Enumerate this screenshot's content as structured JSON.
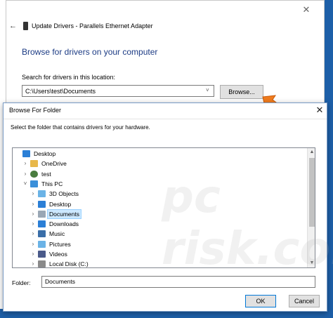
{
  "update_drivers": {
    "title": "Update Drivers - Parallels Ethernet Adapter",
    "heading": "Browse for drivers on your computer",
    "search_label": "Search for drivers in this location:",
    "path_value": "C:\\Users\\test\\Documents",
    "browse_label": "Browse..."
  },
  "browse_folder": {
    "title": "Browse For Folder",
    "instruction": "Select the folder that contains drivers for your hardware.",
    "tree": [
      {
        "label": "Desktop",
        "indent": 0,
        "chevron": "",
        "icon": "desktop-folder-icon",
        "color": "#2b7fd6"
      },
      {
        "label": "OneDrive",
        "indent": 1,
        "chevron": "›",
        "icon": "onedrive-folder-icon",
        "color": "#e8b84a"
      },
      {
        "label": "test",
        "indent": 1,
        "chevron": "›",
        "icon": "user-icon",
        "color": "#4a7c3f"
      },
      {
        "label": "This PC",
        "indent": 1,
        "chevron": "˅",
        "icon": "pc-icon",
        "color": "#3a8fd9"
      },
      {
        "label": "3D Objects",
        "indent": 2,
        "chevron": "›",
        "icon": "3d-objects-icon",
        "color": "#6bb3e6"
      },
      {
        "label": "Desktop",
        "indent": 2,
        "chevron": "›",
        "icon": "desktop-icon",
        "color": "#2b7fd6"
      },
      {
        "label": "Documents",
        "indent": 2,
        "chevron": "›",
        "icon": "documents-icon",
        "color": "#9aa7b5",
        "selected": true
      },
      {
        "label": "Downloads",
        "indent": 2,
        "chevron": "›",
        "icon": "downloads-icon",
        "color": "#2b7fd6"
      },
      {
        "label": "Music",
        "indent": 2,
        "chevron": "›",
        "icon": "music-icon",
        "color": "#3a6ea8"
      },
      {
        "label": "Pictures",
        "indent": 2,
        "chevron": "›",
        "icon": "pictures-icon",
        "color": "#6bb3e6"
      },
      {
        "label": "Videos",
        "indent": 2,
        "chevron": "›",
        "icon": "videos-icon",
        "color": "#4a5a8a"
      },
      {
        "label": "Local Disk (C:)",
        "indent": 2,
        "chevron": "›",
        "icon": "disk-icon",
        "color": "#8a8a8a"
      }
    ],
    "folder_label": "Folder:",
    "folder_value": "Documents",
    "ok_label": "OK",
    "cancel_label": "Cancel"
  },
  "colors": {
    "accent": "#0078d7",
    "heading": "#1c3b84",
    "selection": "#cce8ff",
    "arrow": "#f07c1e",
    "desktop_background": "#2b6cb0"
  },
  "watermark": "pc risk.com"
}
